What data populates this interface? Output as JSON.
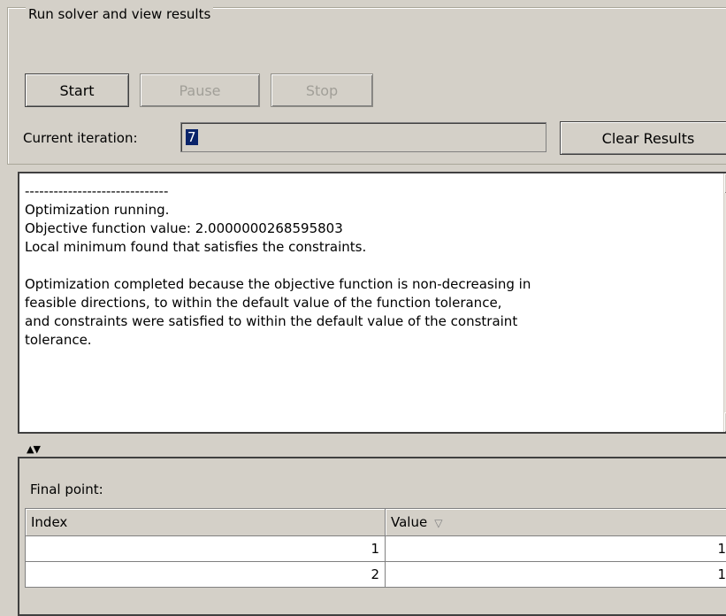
{
  "group": {
    "title": "Run solver and view results"
  },
  "buttons": {
    "start": "Start",
    "pause": "Pause",
    "stop": "Stop",
    "clear_results": "Clear Results"
  },
  "iteration": {
    "label": "Current iteration:",
    "value": "7"
  },
  "results": {
    "text": "------------------------------\nOptimization running.\nObjective function value: 2.0000000268595803\nLocal minimum found that satisfies the constraints.\n\nOptimization completed because the objective function is non-decreasing in\nfeasible directions, to within the default value of the function tolerance,\nand constraints were satisfied to within the default value of the constraint\ntolerance."
  },
  "final_point": {
    "label": "Final point:",
    "columns": [
      "Index",
      "Value"
    ],
    "rows": [
      {
        "index": "1",
        "value": "1"
      },
      {
        "index": "2",
        "value": "1"
      }
    ]
  },
  "icons": {
    "scroll_up": "scroll-up-arrow-icon",
    "scroll_down": "scroll-down-arrow-icon",
    "split_divider": "split-divider-arrows-icon",
    "sort": "sort-descending-icon"
  }
}
